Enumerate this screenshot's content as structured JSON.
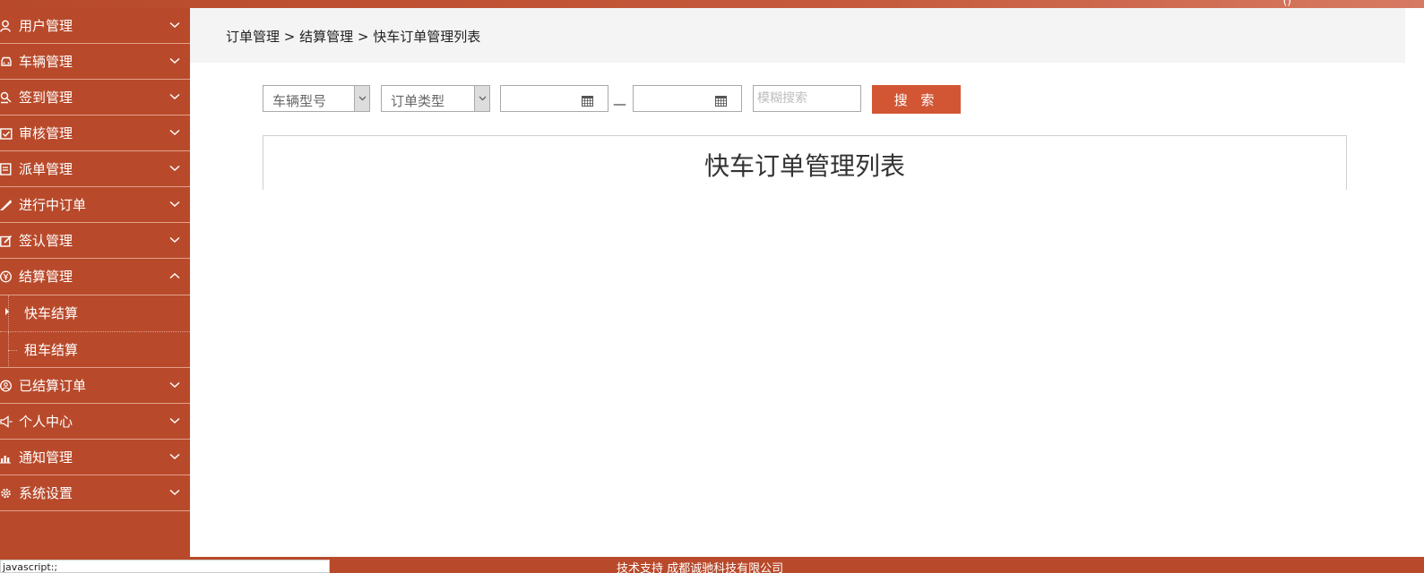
{
  "topbar": {
    "corner_glyph": "()"
  },
  "sidebar": {
    "items": [
      {
        "label": "用户管理",
        "icon": "user-icon",
        "expanded": false
      },
      {
        "label": "车辆管理",
        "icon": "car-icon",
        "expanded": false
      },
      {
        "label": "签到管理",
        "icon": "checkin-icon",
        "expanded": false
      },
      {
        "label": "审核管理",
        "icon": "calendar-check-icon",
        "expanded": false
      },
      {
        "label": "派单管理",
        "icon": "list-icon",
        "expanded": false
      },
      {
        "label": "进行中订单",
        "icon": "pen-icon",
        "expanded": false
      },
      {
        "label": "签认管理",
        "icon": "edit-icon",
        "expanded": false
      },
      {
        "label": "结算管理",
        "icon": "yen-icon",
        "expanded": true,
        "children": [
          {
            "label": "快车结算",
            "active": true
          },
          {
            "label": "租车结算",
            "active": false
          }
        ]
      },
      {
        "label": "已结算订单",
        "icon": "person-circle-icon",
        "expanded": false
      },
      {
        "label": "个人中心",
        "icon": "speaker-icon",
        "expanded": false
      },
      {
        "label": "通知管理",
        "icon": "bar-chart-icon",
        "expanded": false
      },
      {
        "label": "系统设置",
        "icon": "gear-icon",
        "expanded": false
      }
    ]
  },
  "breadcrumb": "订单管理 > 结算管理 > 快车订单管理列表",
  "filters": {
    "vehicle_type": "车辆型号",
    "order_type": "订单类型",
    "date_start": "",
    "date_end": "",
    "date_separator": "—",
    "search_placeholder": "模糊搜索",
    "search_button": "搜 索"
  },
  "panel": {
    "title": "快车订单管理列表"
  },
  "footer": {
    "status_text": "javascript:;",
    "support_text": "技术支持 成都诚驰科技有限公司"
  },
  "colors": {
    "sidebar": "#b84a2b",
    "accent": "#d35634",
    "divider": "#e3a089"
  }
}
